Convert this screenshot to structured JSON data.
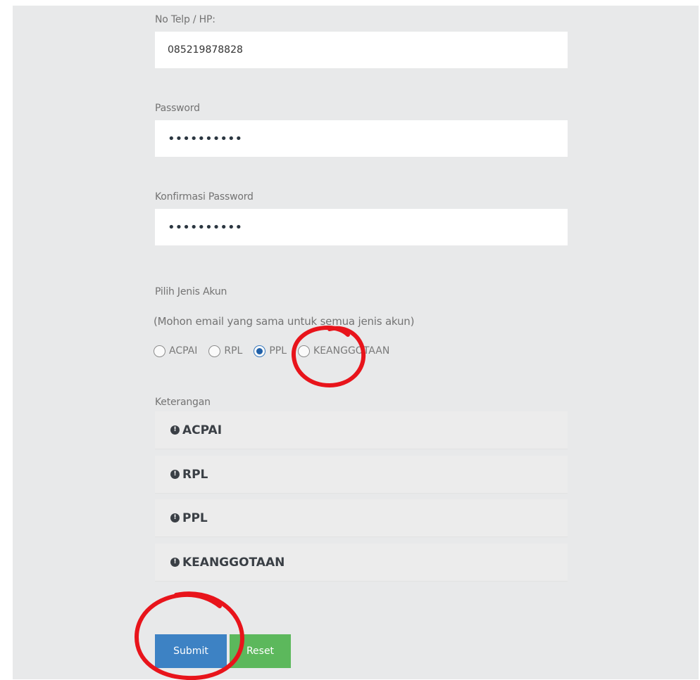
{
  "form": {
    "phone_label": "No Telp / HP:",
    "phone_value": "085219878828",
    "password_label": "Password",
    "password_value": "••••••••••",
    "confirm_label": "Konfirmasi Password",
    "confirm_value": "••••••••••",
    "account_type_label": "Pilih Jenis Akun",
    "account_type_note": "(Mohon email yang sama untuk semua jenis akun)",
    "account_options": [
      {
        "label": "ACPAI",
        "selected": false
      },
      {
        "label": "RPL",
        "selected": false
      },
      {
        "label": "PPL",
        "selected": true
      },
      {
        "label": "KEANGGOTAAN",
        "selected": false
      }
    ],
    "info_label": "Keterangan",
    "info_items": [
      {
        "title": "ACPAI",
        "icon": "info-circle-icon"
      },
      {
        "title": "RPL",
        "icon": "info-circle-icon"
      },
      {
        "title": "PPL",
        "icon": "info-circle-icon"
      },
      {
        "title": "KEANGGOTAAN",
        "icon": "info-circle-icon"
      }
    ],
    "submit_label": "Submit",
    "reset_label": "Reset"
  },
  "colors": {
    "panel_bg": "#e8e9ea",
    "submit": "#3d82c4",
    "reset": "#5cb85c",
    "annotation": "#e8141b"
  }
}
